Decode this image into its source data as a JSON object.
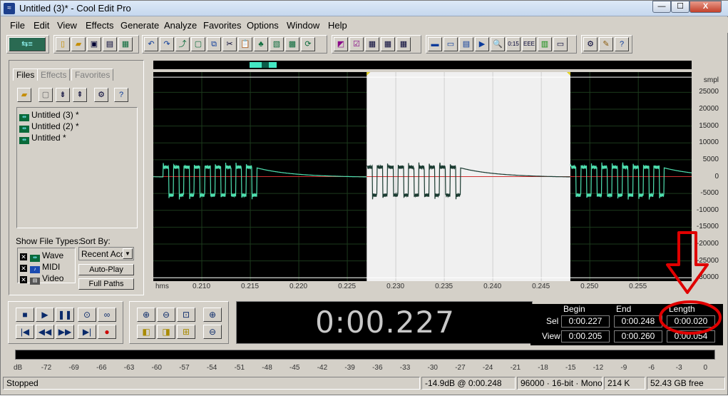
{
  "window": {
    "title": "Untitled (3)* - Cool Edit Pro",
    "app_icon": "cool-edit-icon"
  },
  "titlebar_buttons": {
    "minimize": "—",
    "maximize": "☐",
    "close": "X"
  },
  "menu": [
    "File",
    "Edit",
    "View",
    "Effects",
    "Generate",
    "Analyze",
    "Favorites",
    "Options",
    "Window",
    "Help"
  ],
  "left_panel": {
    "tabs": [
      "Files",
      "Effects",
      "Favorites"
    ],
    "active_tab": "Files",
    "files": [
      "Untitled (3) *",
      "Untitled (2) *",
      "Untitled *"
    ],
    "show_file_types_label": "Show File Types:",
    "sort_by_label": "Sort By:",
    "file_types": [
      "Wave",
      "MIDI",
      "Video"
    ],
    "sort_value": "Recent Acc",
    "auto_play_label": "Auto-Play",
    "full_paths_label": "Full Paths"
  },
  "waveform": {
    "ruler_unit": "hms",
    "ruler_ticks": [
      "0.210",
      "0.215",
      "0.220",
      "0.225",
      "0.230",
      "0.235",
      "0.240",
      "0.245",
      "0.250",
      "0.255"
    ],
    "view_start": 0.205,
    "view_end": 0.2605,
    "selection_start": 0.227,
    "selection_end": 0.248,
    "amp_unit": "smpl",
    "amp_labels": [
      "25000",
      "20000",
      "15000",
      "10000",
      "5000",
      "0",
      "-5000",
      "-10000",
      "-15000",
      "-20000",
      "-25000",
      "-30000"
    ],
    "amp_range": [
      -31000,
      31000
    ],
    "colors": {
      "wave": "#4fe0b0",
      "selected_bg": "#f0f0f0",
      "selected_wave": "#1a3a30",
      "center_line": "#d03030",
      "bg": "#000000"
    }
  },
  "transport": {
    "time_display": "0:00.227",
    "buttons": [
      "stop",
      "play",
      "pause",
      "play-to-end",
      "loop",
      "go-to-begin",
      "rewind",
      "fast-forward",
      "go-to-end",
      "record"
    ],
    "zoom_buttons": [
      "zoom-in-horizontal",
      "zoom-out-horizontal",
      "zoom-full",
      "zoom-in-vertical",
      "zoom-left",
      "zoom-right",
      "zoom-selection",
      "zoom-out-vertical"
    ]
  },
  "selection_info": {
    "headers": {
      "begin": "Begin",
      "end": "End",
      "length": "Length"
    },
    "sel_label": "Sel",
    "view_label": "View",
    "sel": {
      "begin": "0:00.227",
      "end": "0:00.248",
      "length": "0:00.020"
    },
    "view": {
      "begin": "0:00.205",
      "end": "0:00.260",
      "length": "0:00.054"
    }
  },
  "level_meter": {
    "labels": [
      "dB",
      "-72",
      "-69",
      "-66",
      "-63",
      "-60",
      "-57",
      "-54",
      "-51",
      "-48",
      "-45",
      "-42",
      "-39",
      "-36",
      "-33",
      "-30",
      "-27",
      "-24",
      "-21",
      "-18",
      "-15",
      "-12",
      "-9",
      "-6",
      "-3",
      "0"
    ]
  },
  "status": {
    "state": "Stopped",
    "cursor": "-14.9dB @  0:00.248",
    "format": "96000 · 16-bit · Mono",
    "size": "214 K",
    "free": "52.43 GB free"
  }
}
